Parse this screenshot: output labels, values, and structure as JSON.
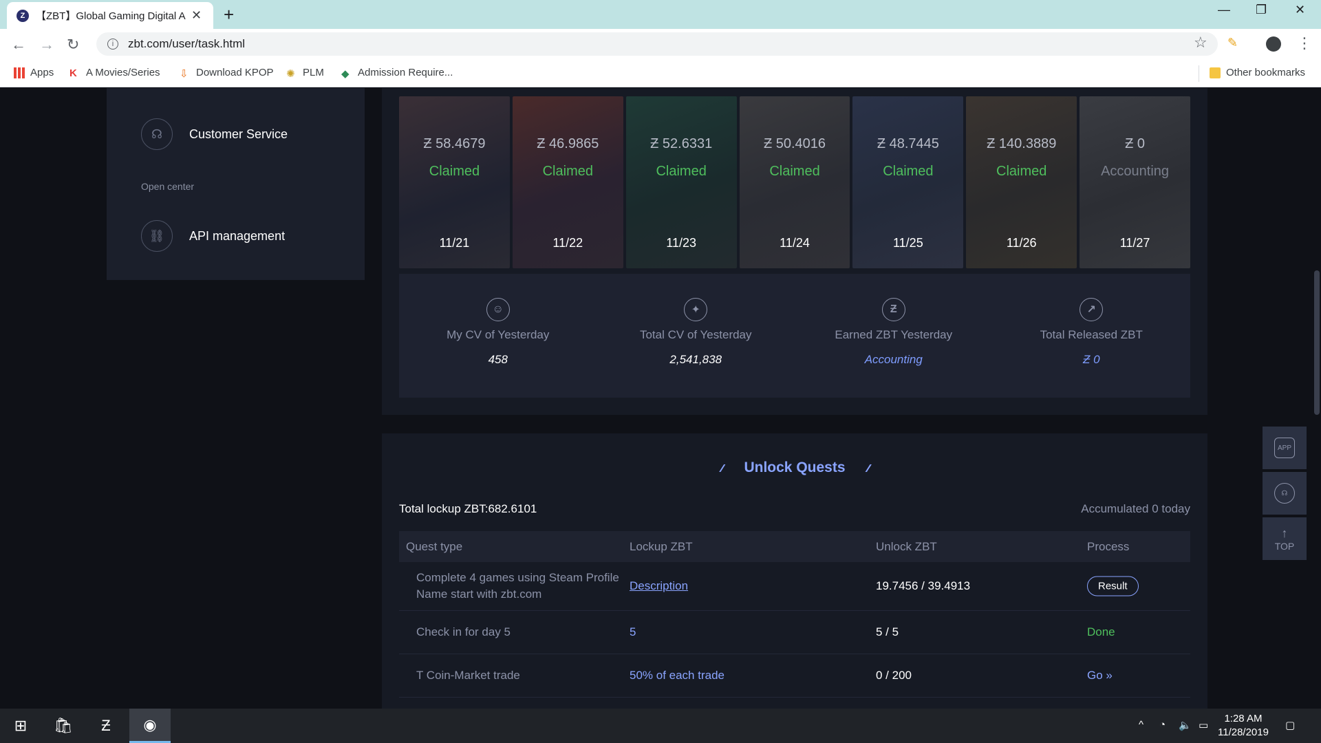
{
  "browser": {
    "tab_title": "【ZBT】Global Gaming Digital Asse",
    "url": "zbt.com/user/task.html",
    "bookmarks": [
      "Apps",
      "A Movies/Series",
      "Download KPOP",
      "PLM",
      "Admission Require...",
      "Other bookmarks"
    ]
  },
  "sidebar": {
    "items": [
      {
        "label": "Customer Service",
        "icon": "headset-icon"
      },
      {
        "label": "API management",
        "icon": "link-icon"
      }
    ],
    "section_label": "Open center"
  },
  "daily": {
    "currency_symbol": "Ƶ",
    "days": [
      {
        "amount": "58.4679",
        "status": "Claimed",
        "date": "11/21"
      },
      {
        "amount": "46.9865",
        "status": "Claimed",
        "date": "11/22"
      },
      {
        "amount": "52.6331",
        "status": "Claimed",
        "date": "11/23"
      },
      {
        "amount": "50.4016",
        "status": "Claimed",
        "date": "11/24"
      },
      {
        "amount": "48.7445",
        "status": "Claimed",
        "date": "11/25"
      },
      {
        "amount": "140.3889",
        "status": "Claimed",
        "date": "11/26"
      },
      {
        "amount": "0",
        "status": "Accounting",
        "date": "11/27"
      }
    ]
  },
  "stats": [
    {
      "label": "My CV of Yesterday",
      "value": "458",
      "icon": "user-icon"
    },
    {
      "label": "Total CV of Yesterday",
      "value": "2,541,838",
      "icon": "network-icon"
    },
    {
      "label": "Earned ZBT Yesterday",
      "value": "Accounting",
      "icon": "zbt-coin-icon"
    },
    {
      "label": "Total Released ZBT",
      "value": "Ƶ 0",
      "icon": "trend-up-icon"
    }
  ],
  "quests": {
    "title": "Unlock Quests",
    "total_lockup": "Total lockup ZBT:682.6101",
    "accumulated": "Accumulated 0 today",
    "columns": [
      "Quest type",
      "Lockup ZBT",
      "Unlock ZBT",
      "Process"
    ],
    "rows": [
      {
        "type": "Complete 4 games using Steam Profile Name start with zbt.com",
        "lockup": "Description",
        "unlock": "19.7456 / 39.4913",
        "process": "Result"
      },
      {
        "type": "Check in for day 5",
        "lockup": "5",
        "unlock": "5 / 5",
        "process": "Done"
      },
      {
        "type": "T Coin-Market trade",
        "lockup": "50% of each trade",
        "unlock": "0 / 200",
        "process": "Go »"
      }
    ]
  },
  "float_panel": {
    "app": "APP",
    "top": "TOP"
  },
  "taskbar": {
    "time": "1:28 AM",
    "date": "11/28/2019"
  },
  "colors": {
    "claimed": "#4fbf5d",
    "accent": "#8aa4ff",
    "panel": "#161a24"
  }
}
